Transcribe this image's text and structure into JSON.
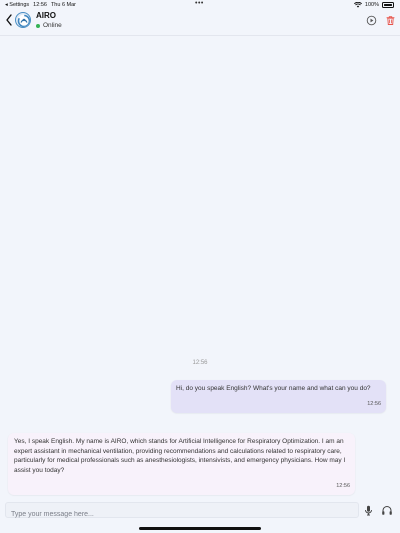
{
  "status_bar": {
    "back_label": "◂ Settings",
    "time": "12:56",
    "date": "Thu 6 Mar",
    "dots": "•••",
    "battery": "100%"
  },
  "header": {
    "title": "AIRO",
    "status": "Online",
    "accent": "#4b8fc4",
    "online_color": "#34b254",
    "delete_color": "#e8544b"
  },
  "chat": {
    "time_separator": "12:56",
    "messages": [
      {
        "role": "user",
        "text": "Hi, do you speak English? What's your name and what can you do?",
        "time": "12:56"
      },
      {
        "role": "assistant",
        "text": "Yes, I speak English. My name is AIRO, which stands for Artificial Intelligence for Respiratory Optimization. I am an expert assistant in mechanical ventilation, providing recommendations and calculations related to respiratory care, particularly for medical professionals such as anesthesiologists, intensivists, and emergency physicians. How may I assist you today?",
        "time": "12:56"
      }
    ]
  },
  "composer": {
    "placeholder": "Type your message here...",
    "icons": [
      "microphone-icon",
      "headset-icon"
    ]
  }
}
